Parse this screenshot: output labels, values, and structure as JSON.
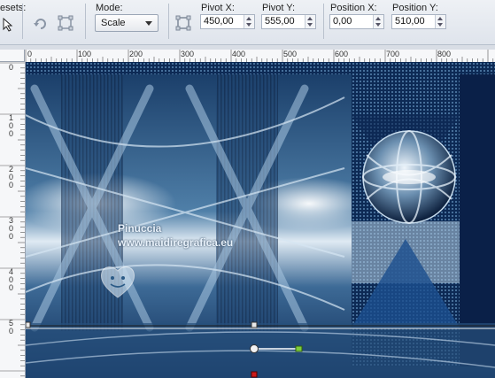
{
  "toolbar": {
    "presets_label": "esets:",
    "mode_label": "Mode:",
    "mode_value": "Scale",
    "pivot_x_label": "Pivot X:",
    "pivot_x_value": "450,00",
    "pivot_y_label": "Pivot Y:",
    "pivot_y_value": "555,00",
    "position_x_label": "Position X:",
    "position_x_value": "0,00",
    "position_y_label": "Position Y:",
    "position_y_value": "510,00"
  },
  "ruler_top": [
    "0",
    "100",
    "200",
    "300",
    "400",
    "500",
    "600",
    "700",
    "800"
  ],
  "ruler_left": [
    "0",
    "1\n0\n0",
    "2\n0\n0",
    "3\n0\n0",
    "4\n0\n0",
    "5\n0"
  ],
  "watermark": {
    "line1": "Pinuccia",
    "line2": "www.maidiregrafica.eu"
  },
  "colors": {
    "deep_blue": "#0d2a55",
    "steel_blue": "#4f7fa8",
    "ice": "#dfeaf3",
    "handle_green": "#7ccc3a"
  }
}
